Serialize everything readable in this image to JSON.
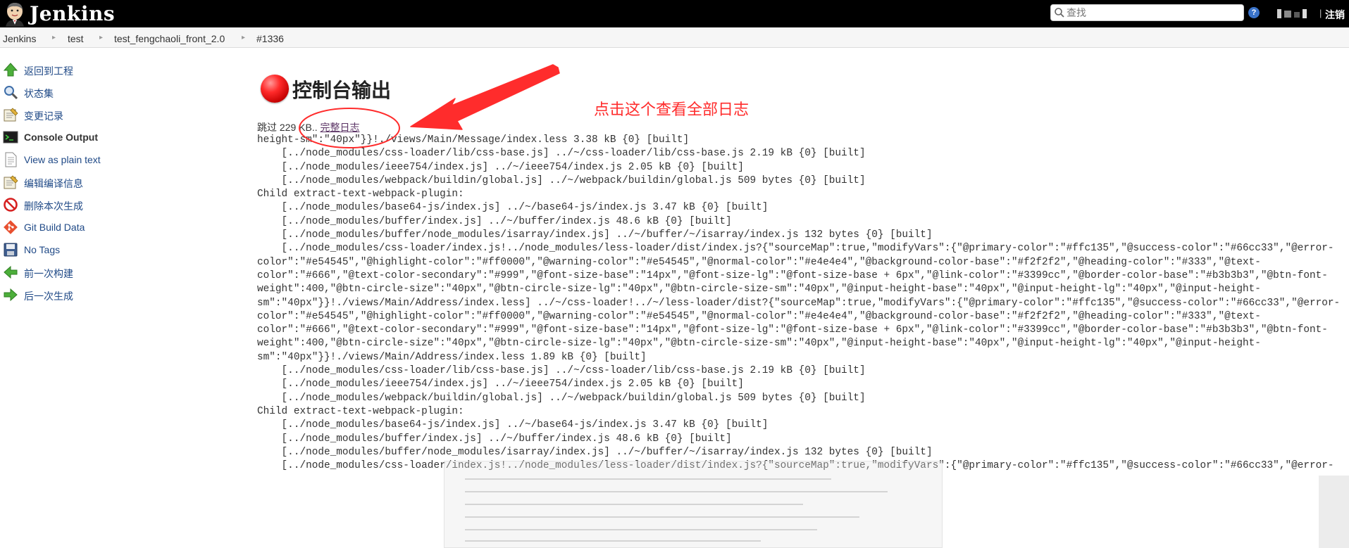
{
  "header": {
    "app_name": "Jenkins",
    "search_placeholder": "查找",
    "help_label": "?",
    "logout_label": "注销"
  },
  "breadcrumb": [
    "Jenkins",
    "test",
    "test_fengchaoli_front_2.0",
    "#1336"
  ],
  "sidebar": {
    "items": [
      {
        "label": "返回到工程",
        "icon": "up-arrow-icon"
      },
      {
        "label": "状态集",
        "icon": "magnifier-icon"
      },
      {
        "label": "变更记录",
        "icon": "notepad-icon"
      },
      {
        "label": "Console Output",
        "icon": "terminal-icon",
        "active": true
      },
      {
        "label": "View as plain text",
        "icon": "document-icon"
      },
      {
        "label": "编辑编译信息",
        "icon": "notepad-pencil-icon"
      },
      {
        "label": "删除本次生成",
        "icon": "no-entry-icon"
      },
      {
        "label": "Git Build Data",
        "icon": "git-icon"
      },
      {
        "label": "No Tags",
        "icon": "floppy-icon"
      },
      {
        "label": "前一次构建",
        "icon": "left-arrow-icon"
      },
      {
        "label": "后一次生成",
        "icon": "right-arrow-icon"
      }
    ]
  },
  "main": {
    "title": "控制台输出",
    "skip_text": "跳过 229 KB.. ",
    "full_log_link": "完整日志",
    "console_lines": [
      "height-sm\":\"40px\"}}!./views/Main/Message/index.less 3.38 kB {0} [built]",
      "    [../node_modules/css-loader/lib/css-base.js] ../~/css-loader/lib/css-base.js 2.19 kB {0} [built]",
      "    [../node_modules/ieee754/index.js] ../~/ieee754/index.js 2.05 kB {0} [built]",
      "    [../node_modules/webpack/buildin/global.js] ../~/webpack/buildin/global.js 509 bytes {0} [built]",
      "Child extract-text-webpack-plugin:",
      "    [../node_modules/base64-js/index.js] ../~/base64-js/index.js 3.47 kB {0} [built]",
      "    [../node_modules/buffer/index.js] ../~/buffer/index.js 48.6 kB {0} [built]",
      "    [../node_modules/buffer/node_modules/isarray/index.js] ../~/buffer/~/isarray/index.js 132 bytes {0} [built]",
      "    [../node_modules/css-loader/index.js!../node_modules/less-loader/dist/index.js?{\"sourceMap\":true,\"modifyVars\":{\"@primary-color\":\"#ffc135\",\"@success-color\":\"#66cc33\",\"@error-",
      "color\":\"#e54545\",\"@highlight-color\":\"#ff0000\",\"@warning-color\":\"#e54545\",\"@normal-color\":\"#e4e4e4\",\"@background-color-base\":\"#f2f2f2\",\"@heading-color\":\"#333\",\"@text-",
      "color\":\"#666\",\"@text-color-secondary\":\"#999\",\"@font-size-base\":\"14px\",\"@font-size-lg\":\"@font-size-base + 6px\",\"@link-color\":\"#3399cc\",\"@border-color-base\":\"#b3b3b3\",\"@btn-font-",
      "weight\":400,\"@btn-circle-size\":\"40px\",\"@btn-circle-size-lg\":\"40px\",\"@btn-circle-size-sm\":\"40px\",\"@input-height-base\":\"40px\",\"@input-height-lg\":\"40px\",\"@input-height-",
      "sm\":\"40px\"}}!./views/Main/Address/index.less] ../~/css-loader!../~/less-loader/dist?{\"sourceMap\":true,\"modifyVars\":{\"@primary-color\":\"#ffc135\",\"@success-color\":\"#66cc33\",\"@error-",
      "color\":\"#e54545\",\"@highlight-color\":\"#ff0000\",\"@warning-color\":\"#e54545\",\"@normal-color\":\"#e4e4e4\",\"@background-color-base\":\"#f2f2f2\",\"@heading-color\":\"#333\",\"@text-",
      "color\":\"#666\",\"@text-color-secondary\":\"#999\",\"@font-size-base\":\"14px\",\"@font-size-lg\":\"@font-size-base + 6px\",\"@link-color\":\"#3399cc\",\"@border-color-base\":\"#b3b3b3\",\"@btn-font-",
      "weight\":400,\"@btn-circle-size\":\"40px\",\"@btn-circle-size-lg\":\"40px\",\"@btn-circle-size-sm\":\"40px\",\"@input-height-base\":\"40px\",\"@input-height-lg\":\"40px\",\"@input-height-",
      "sm\":\"40px\"}}!./views/Main/Address/index.less 1.89 kB {0} [built]",
      "    [../node_modules/css-loader/lib/css-base.js] ../~/css-loader/lib/css-base.js 2.19 kB {0} [built]",
      "    [../node_modules/ieee754/index.js] ../~/ieee754/index.js 2.05 kB {0} [built]",
      "    [../node_modules/webpack/buildin/global.js] ../~/webpack/buildin/global.js 509 bytes {0} [built]",
      "Child extract-text-webpack-plugin:",
      "    [../node_modules/base64-js/index.js] ../~/base64-js/index.js 3.47 kB {0} [built]",
      "    [../node_modules/buffer/index.js] ../~/buffer/index.js 48.6 kB {0} [built]",
      "    [../node_modules/buffer/node_modules/isarray/index.js] ../~/buffer/~/isarray/index.js 132 bytes {0} [built]",
      "    [../node_modules/css-loader/index.js!../node_modules/less-loader/dist/index.js?{\"sourceMap\":true,\"modifyVars\":{\"@primary-color\":\"#ffc135\",\"@success-color\":\"#66cc33\",\"@error-"
    ]
  },
  "annotation": {
    "text": "点击这个查看全部日志",
    "color": "#ff2c2c"
  },
  "colors": {
    "header_bg": "#000000",
    "link": "#204a87",
    "visited_link": "#5c3566",
    "failure": "#e00000"
  }
}
